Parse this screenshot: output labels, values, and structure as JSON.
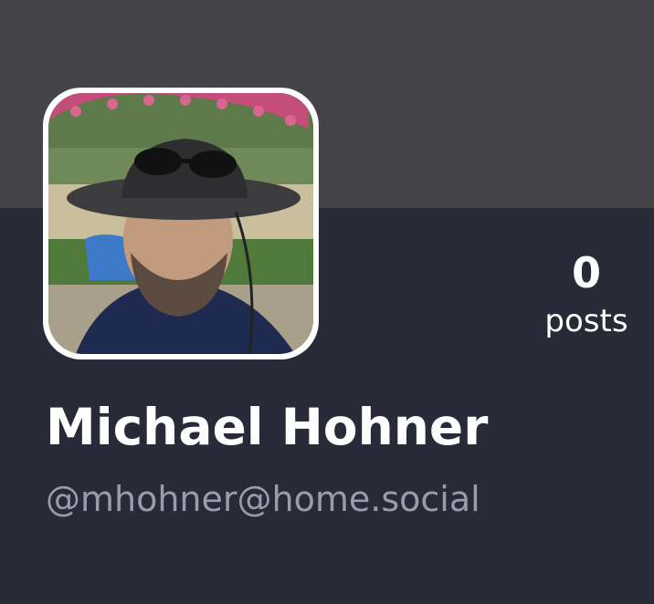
{
  "profile": {
    "display_name": "Michael Hohner",
    "handle": "@mhohner@home.social",
    "avatar_icon": "profile-photo"
  },
  "stats": {
    "posts_count": "0",
    "posts_label": "posts"
  },
  "colors": {
    "banner": "#444446",
    "background": "#282a37",
    "name_text": "#ffffff",
    "handle_text": "#9a9cab"
  }
}
